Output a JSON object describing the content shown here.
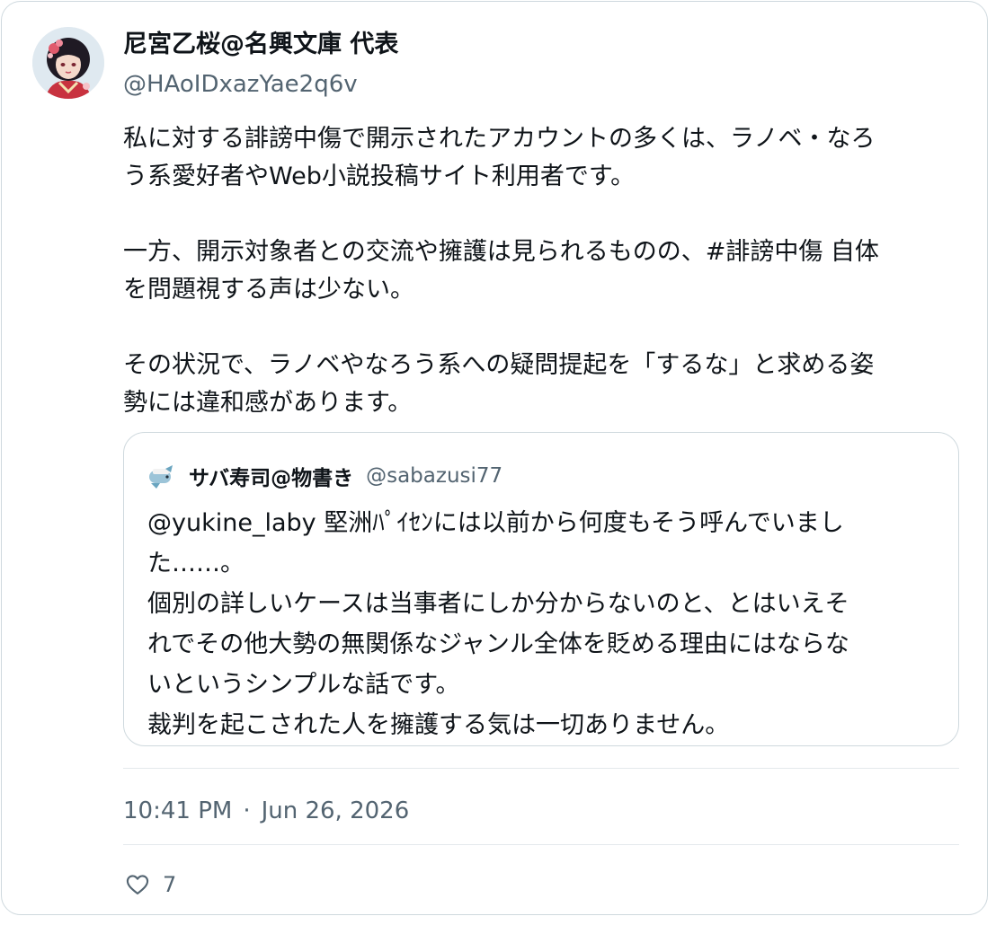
{
  "author": {
    "name": "尼宮乙桜@名興文庫 代表",
    "handle": "@HAoIDxazYae2q6v"
  },
  "tweet": {
    "lines": [
      "私に対する誹謗中傷で開示されたアカウントの多くは、ラノベ・なろ",
      "う系愛好者やWeb小説投稿サイト利用者です。",
      "",
      "一方、開示対象者との交流や擁護は見られるものの、#誹謗中傷 自体",
      "を問題視する声は少ない。",
      "",
      "その状況で、ラノベやなろう系への疑問提起を「するな」と求める姿",
      "勢には違和感があります。"
    ]
  },
  "quoted_tweet": {
    "name": "サバ寿司@物書き",
    "handle": "@sabazusi77",
    "lines": [
      "@yukine_laby 堅洲ﾊﾟｲｾﾝには以前から何度もそう呼んでいまし",
      "た……。",
      "個別の詳しいケースは当事者にしか分からないのと、とはいえそ",
      "れでその他大勢の無関係なジャンル全体を貶める理由にはならな",
      "いというシンプルな話です。",
      "裁判を起こされた人を擁護する気は一切ありません。"
    ]
  },
  "meta": {
    "time": "10:41 PM",
    "separator": "·",
    "date": "Jun 26, 2026"
  },
  "actions": {
    "like_icon": "heart-outline-icon",
    "like_count": "7"
  },
  "colors": {
    "text": "#0f1419",
    "secondary": "#536471",
    "border": "#cfd9de"
  }
}
